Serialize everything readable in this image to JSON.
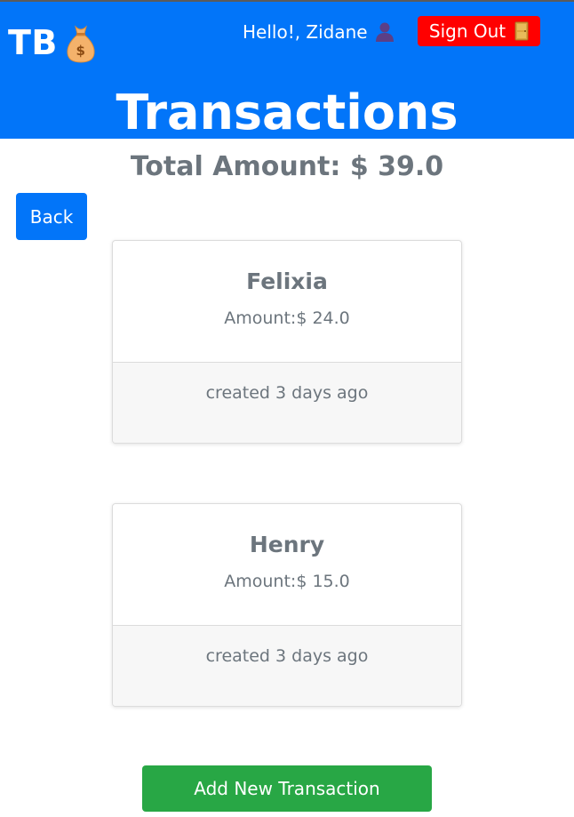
{
  "header": {
    "brand": "TB",
    "brand_icon": "money-bag-icon",
    "greeting": "Hello!, Zidane",
    "greeting_icon": "user-silhouette-icon",
    "signout_label": "Sign Out",
    "signout_icon": "door-icon",
    "title": "Transactions",
    "colors": {
      "header_bg": "#0275f9",
      "signout_bg": "#ff0000"
    }
  },
  "summary": {
    "total": "Total Amount: $ 39.0"
  },
  "actions": {
    "back_label": "Back",
    "add_label": "Add New Transaction",
    "colors": {
      "back_bg": "#0275f9",
      "add_bg": "#28a745"
    }
  },
  "transactions": [
    {
      "name": "Felixia",
      "amount": "Amount:$ 24.0",
      "created": "created 3 days ago"
    },
    {
      "name": "Henry",
      "amount": "Amount:$ 15.0",
      "created": "created 3 days ago"
    }
  ]
}
